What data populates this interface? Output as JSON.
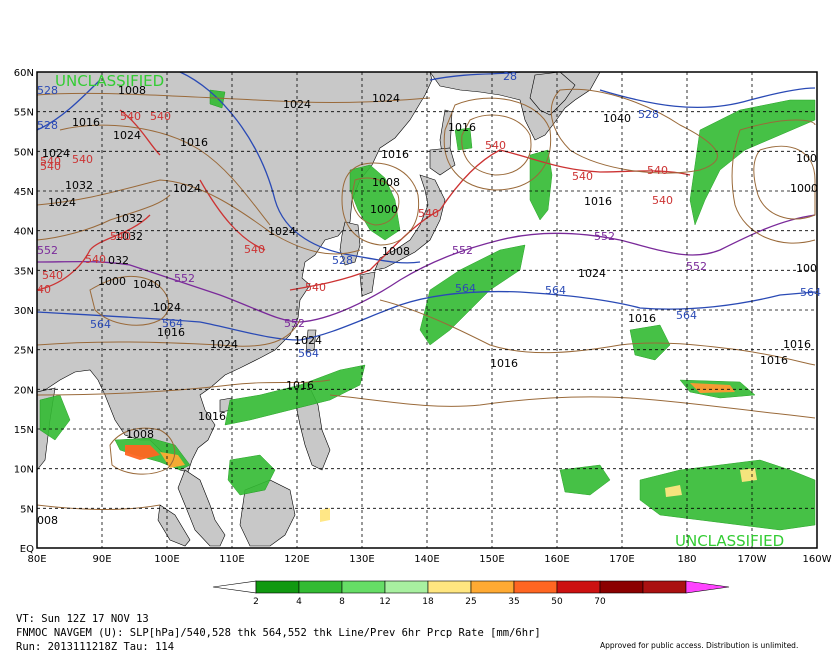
{
  "map": {
    "classification_top": "UNCLASSIFIED",
    "classification_bottom": "UNCLASSIFIED",
    "lat_labels": [
      "60N",
      "55N",
      "50N",
      "45N",
      "40N",
      "35N",
      "30N",
      "25N",
      "20N",
      "15N",
      "10N",
      "5N",
      "EQ"
    ],
    "lon_labels": [
      "80E",
      "90E",
      "100E",
      "110E",
      "120E",
      "130E",
      "140E",
      "150E",
      "160E",
      "170E",
      "180",
      "170W",
      "160W"
    ],
    "colors": {
      "land": "#c8c8c8",
      "ocean": "#ffffff",
      "slp_contour": "#9a6a3a",
      "thickness_540": "#cc3333",
      "thickness_552": "#7a2a9a",
      "thickness_564_528": "#2a4ab5",
      "label_classification": "#33cc33"
    },
    "slp_labels": [
      "1008",
      "1024",
      "1024",
      "1016",
      "1024",
      "1016",
      "1024",
      "1016",
      "1032",
      "1024",
      "1024",
      "1016",
      "1008",
      "1000",
      "1032",
      "1032",
      "1024",
      "1024",
      "1040",
      "032",
      "1024",
      "1024",
      "1016",
      "1016",
      "1024",
      "1008",
      "1040",
      "1000",
      "100",
      "1016",
      "1016",
      "1016",
      "1016",
      "1008",
      "1016",
      "100",
      "008",
      "1016",
      "1000"
    ],
    "thickness_labels": {
      "540": [
        "540",
        "540",
        "540",
        "540",
        "540",
        "540",
        "540",
        "540",
        "540",
        "540",
        "540",
        "540",
        "540",
        "540",
        "540",
        "40"
      ],
      "552": [
        "552",
        "552",
        "552",
        "552",
        "552",
        "552"
      ],
      "564": [
        "564",
        "564",
        "564",
        "564",
        "564",
        "564",
        "564"
      ],
      "528": [
        "528",
        "528",
        "528",
        "28",
        "528"
      ]
    }
  },
  "legend": {
    "values": [
      "2",
      "4",
      "8",
      "12",
      "18",
      "25",
      "35",
      "50",
      "70"
    ],
    "colors": [
      "#ffffff",
      "#119911",
      "#33bb33",
      "#66dd66",
      "#a8f0a0",
      "#ffe680",
      "#ffaa33",
      "#ff6622",
      "#cc1111",
      "#8b0000",
      "#aa1111",
      "#ff44ff"
    ]
  },
  "footer": {
    "line1": "VT: Sun 12Z 17 NOV 13",
    "line2": "FNMOC NAVGEM (U): SLP[hPa]/540,528 thk 564,552 thk Line/Prev 6hr Prcp Rate [mm/6hr]",
    "line3": "Run: 2013111218Z Tau: 114",
    "approved": "Approved for public access. Distribution is unlimited."
  }
}
